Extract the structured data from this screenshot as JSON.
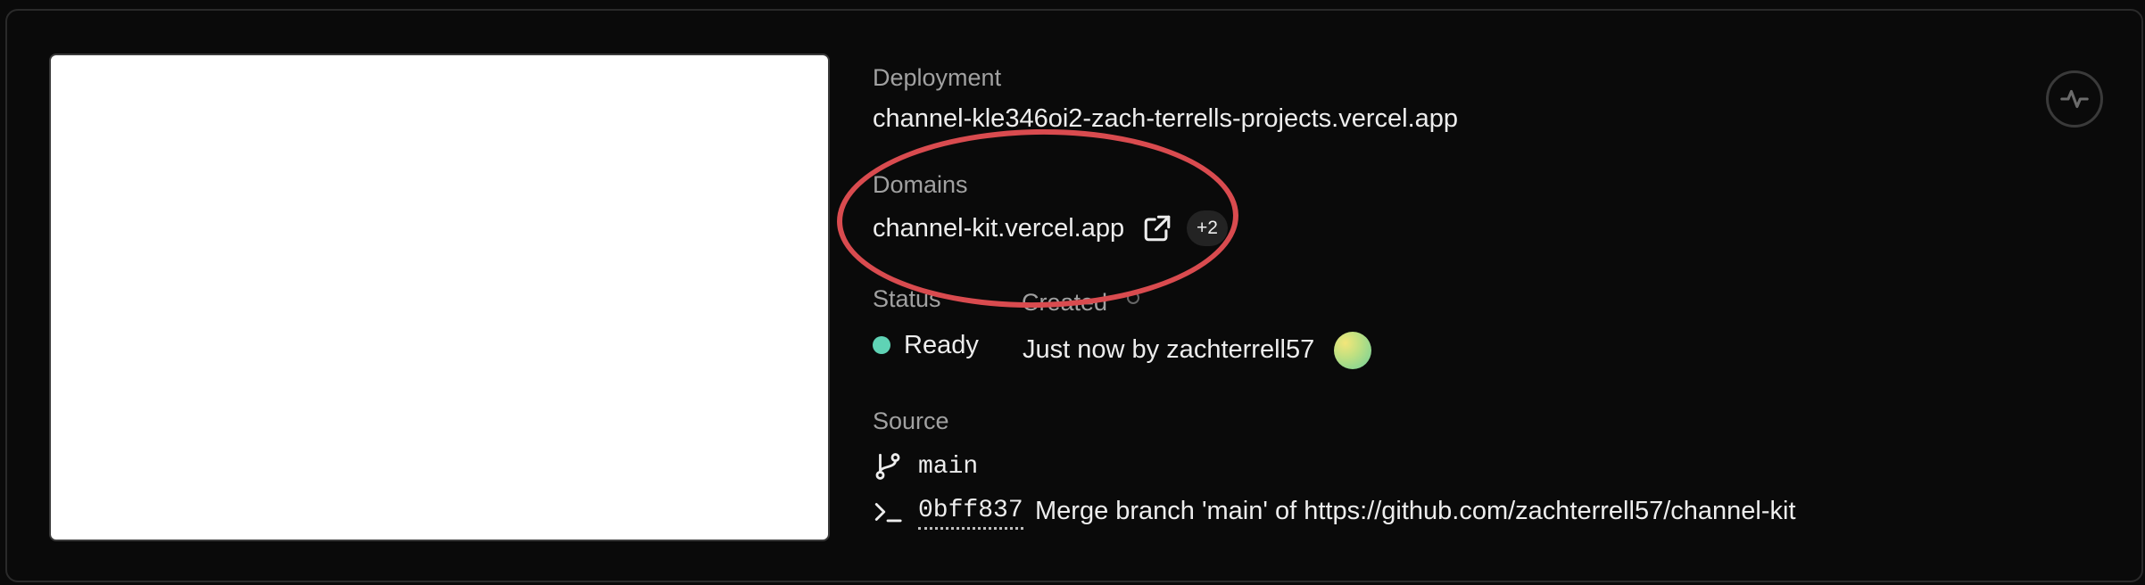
{
  "deployment": {
    "label": "Deployment",
    "url": "channel-kle346oi2-zach-terrells-projects.vercel.app"
  },
  "domains": {
    "label": "Domains",
    "primary": "channel-kit.vercel.app",
    "extra_count": "+2"
  },
  "status": {
    "label": "Status",
    "value": "Ready",
    "color": "#5fd3b5"
  },
  "created": {
    "label": "Created",
    "value": "Just now by zachterrell57"
  },
  "source": {
    "label": "Source",
    "branch": "main",
    "commit_hash": "0bff837",
    "commit_message": "Merge branch 'main' of https://github.com/zachterrell57/channel-kit"
  },
  "icons": {
    "external_link": "external-link-icon",
    "branch": "git-branch-icon",
    "commit": "terminal-icon",
    "activity": "activity-icon",
    "info": "info-icon"
  },
  "colors": {
    "background": "#0a0a0a",
    "annotation": "#d94b4f",
    "muted_text": "#a1a1a1",
    "text": "#ededed"
  }
}
